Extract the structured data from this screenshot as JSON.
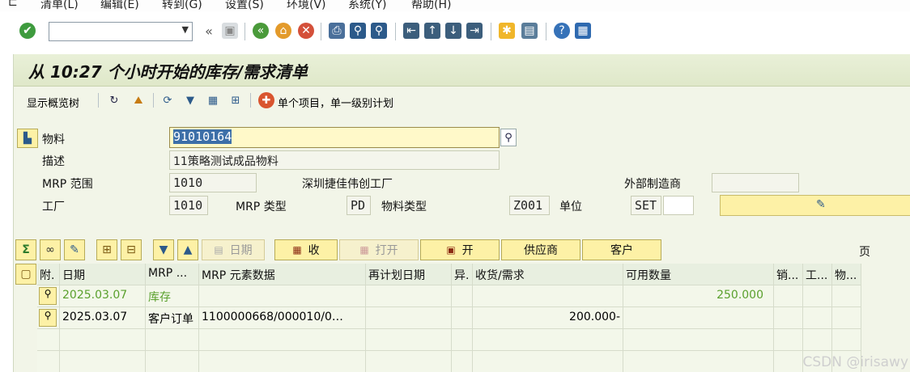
{
  "menu": [
    "清单(L)",
    "编辑(E)",
    "转到(G)",
    "设置(S)",
    "环境(V)",
    "系统(Y)",
    "帮助(H)"
  ],
  "toolbar": {
    "command_value": "",
    "back_glyph": "«"
  },
  "title": "从 10:27 个小时开始的库存/需求清单",
  "appbar": {
    "display_tree": "显示概览树",
    "single_item": "单个项目，单一级别计划"
  },
  "form": {
    "material_label": "物料",
    "material_value": "91010164",
    "description_label": "描述",
    "description_value": "11策略测试成品物料",
    "mrp_area_label": "MRP 范围",
    "mrp_area_value": "1010",
    "mrp_area_text": "深圳捷佳伟创工厂",
    "ext_manufacturer_label": "外部制造商",
    "ext_manufacturer_value": "",
    "plant_label": "工厂",
    "plant_value": "1010",
    "mrp_type_label": "MRP 类型",
    "mrp_type_value": "PD",
    "material_type_label": "物料类型",
    "material_type_value": "Z001",
    "unit_label": "单位",
    "unit_value": "SET"
  },
  "grid_toolbar": {
    "period": "日期",
    "receive": "收",
    "open": "打开",
    "open2": "开",
    "vendor": "供应商",
    "customer": "客户",
    "page": "页"
  },
  "grid": {
    "headers": [
      "附.",
      "日期",
      "MRP ...",
      "MRP 元素数据",
      "再计划日期",
      "异.",
      "收货/需求",
      "可用数量",
      "销...",
      "工...",
      "物..."
    ],
    "rows": [
      {
        "date": "2025.03.07",
        "mrp_elem": "库存",
        "elem_data": "",
        "resched": "",
        "exc": "",
        "rec_req": "",
        "avail": "250.000",
        "green": true
      },
      {
        "date": "2025.03.07",
        "mrp_elem": "客户订单",
        "elem_data": "1100000668/000010/0…",
        "resched": "",
        "exc": "",
        "rec_req": "200.000-",
        "avail": "",
        "green": false
      }
    ]
  },
  "watermark": "CSDN @irisawy",
  "colors": {
    "header_green": "#e9f0d8",
    "button_yellow": "#fdf1a6",
    "stock_green": "#5aa02d",
    "selection_blue": "#3d6fa8"
  }
}
